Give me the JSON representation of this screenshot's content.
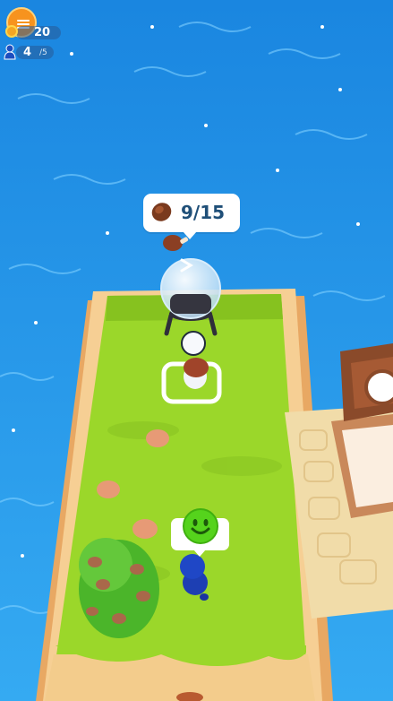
{
  "hud": {
    "menu_icon": "list-icon",
    "coins": "20",
    "coin_icon": "coin-icon",
    "population": "4",
    "population_suffix": "/5",
    "population_icon": "person-icon"
  },
  "resource_bubble": {
    "icon": "meat-icon",
    "count": "9/15"
  },
  "customer_bubble": {
    "icon": "smiley-face-icon"
  },
  "colors": {
    "water": "#1e8fe6",
    "grass": "#9bd72a",
    "sand": "#f4c98a",
    "accent_orange": "#f7931e",
    "hud_text": "#1f4f78"
  }
}
